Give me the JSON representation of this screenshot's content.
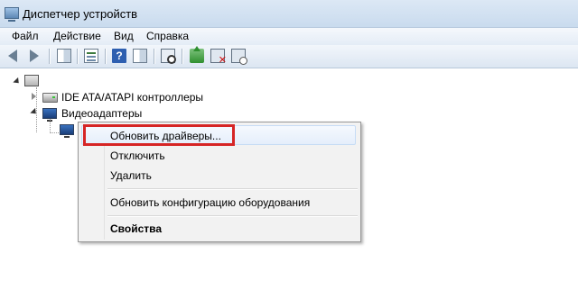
{
  "window": {
    "title": "Диспетчер устройств"
  },
  "menubar": {
    "items": [
      "Файл",
      "Действие",
      "Вид",
      "Справка"
    ]
  },
  "toolbar": {
    "icons": [
      "back-arrow-icon",
      "forward-arrow-icon",
      "console-tree-icon",
      "properties-sheet-icon",
      "help-icon",
      "details-view-icon",
      "scan-hardware-icon",
      "update-driver-icon",
      "uninstall-device-icon",
      "disable-device-icon"
    ]
  },
  "tree": {
    "nodes": [
      {
        "label": "IDE ATA/ATAPI контроллеры",
        "expanded": false
      },
      {
        "label": "Видеоадаптеры",
        "expanded": true
      }
    ]
  },
  "context_menu": {
    "items": [
      {
        "label": "Обновить драйверы...",
        "highlighted": true
      },
      {
        "label": "Отключить"
      },
      {
        "label": "Удалить"
      },
      {
        "label": "Обновить конфигурацию оборудования"
      },
      {
        "label": "Свойства",
        "bold": true
      }
    ],
    "callout_color": "#d62525"
  }
}
